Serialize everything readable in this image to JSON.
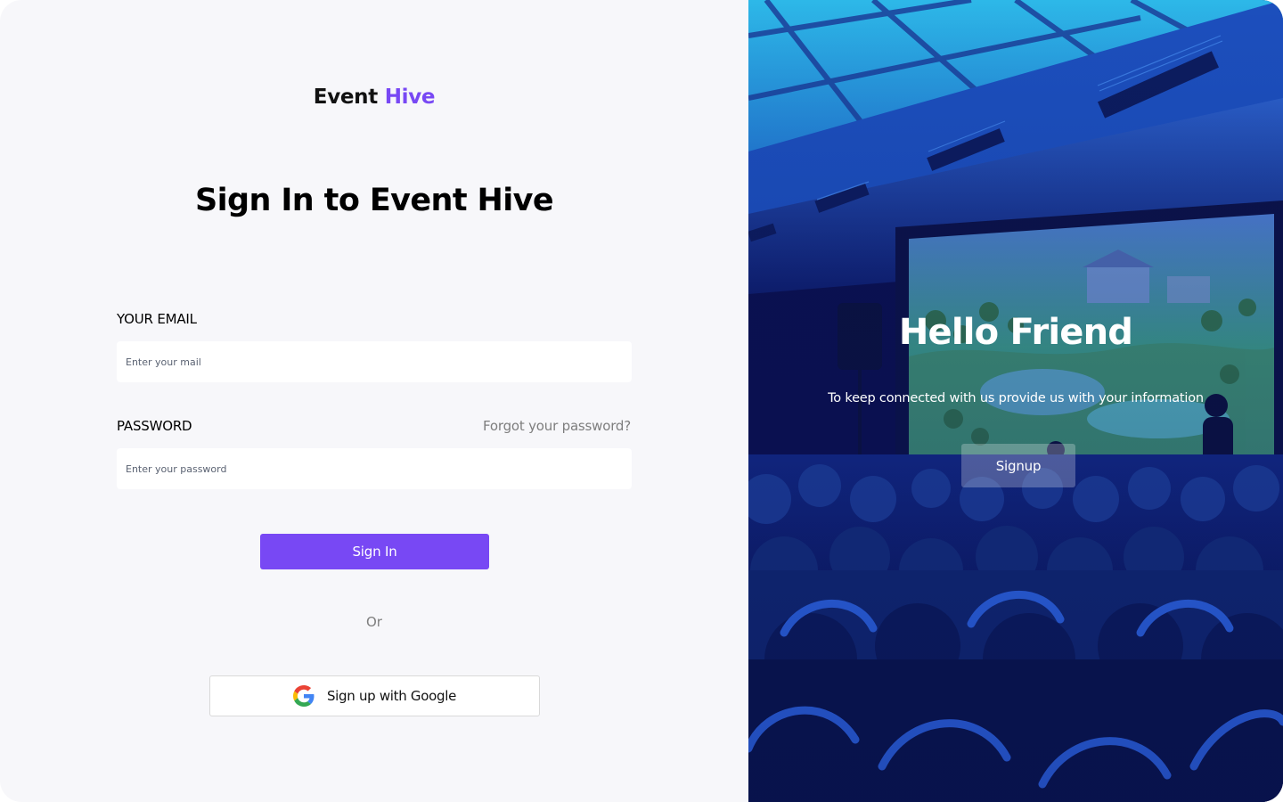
{
  "brand": {
    "name_part1": "Event",
    "name_part2": "Hive",
    "accent_color": "#7848f4"
  },
  "signin": {
    "heading": "Sign In to Event Hive",
    "email_label": "YOUR EMAIL",
    "email_placeholder": "Enter your mail",
    "email_value": "",
    "password_label": "PASSWORD",
    "password_placeholder": "Enter your password",
    "password_value": "",
    "forgot_link": "Forgot your password?",
    "signin_button": "Sign In",
    "or_text": "Or",
    "google_button": "Sign up with Google",
    "google_icon": "google-icon"
  },
  "promo": {
    "title": "Hello Friend",
    "subtitle": "To keep connected with us provide us with your information",
    "signup_button": "Signup",
    "background": "conference-audience-photo"
  }
}
